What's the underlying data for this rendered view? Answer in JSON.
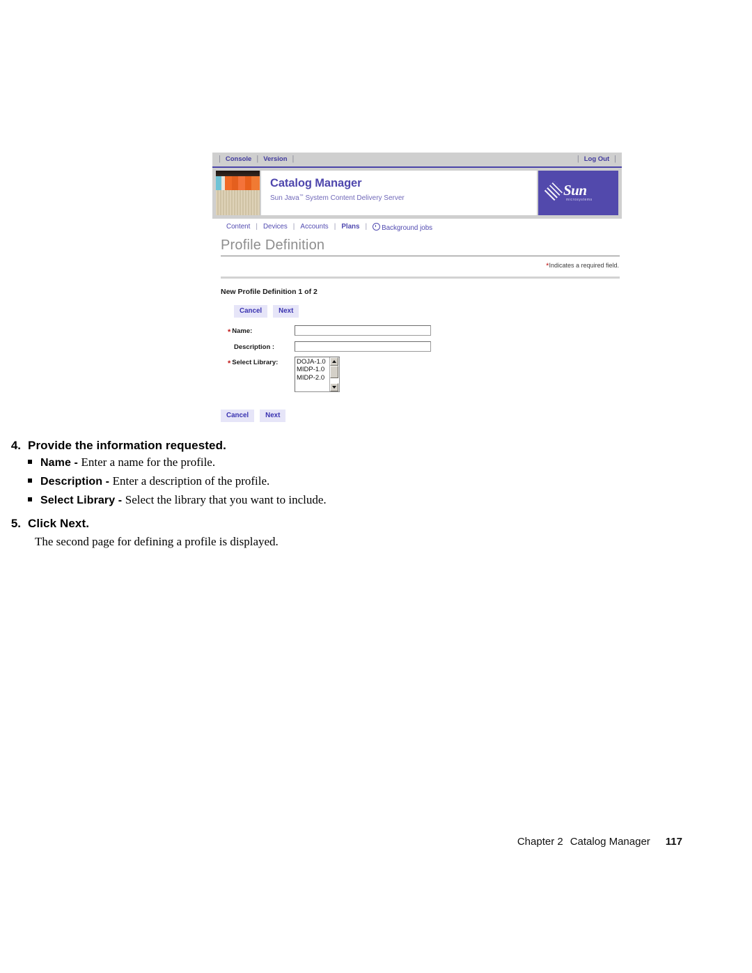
{
  "app": {
    "utility_nav": {
      "left_items": [
        "Console",
        "Version"
      ],
      "right_items": [
        "Log Out"
      ]
    },
    "brand": {
      "title": "Catalog Manager",
      "subtitle_pre": "Sun Java",
      "subtitle_tm": "™",
      "subtitle_post": " System Content Delivery Server",
      "logo_word": "Sun",
      "logo_tagline": "microsystems",
      "logo_bg_color": "#5249ac",
      "title_color": "#4f47ad",
      "banner_bg_color": "#cfcfcf"
    },
    "module_nav": {
      "items": [
        {
          "label": "Content",
          "active": false
        },
        {
          "label": "Devices",
          "active": false
        },
        {
          "label": "Accounts",
          "active": false
        },
        {
          "label": "Plans",
          "active": true
        },
        {
          "label": "Background jobs",
          "active": false,
          "icon": "clock-icon"
        }
      ],
      "separator": "|"
    },
    "page": {
      "heading": "Profile Definition",
      "required_note_star": "*",
      "required_note": "Indicates a required field.",
      "section_title": "New Profile Definition 1 of 2"
    },
    "buttons": {
      "cancel": "Cancel",
      "next": "Next"
    },
    "form": {
      "fields": [
        {
          "label": "Name:",
          "required": true,
          "type": "text",
          "value": "",
          "placeholder": ""
        },
        {
          "label": "Description :",
          "required": false,
          "type": "text",
          "value": "",
          "placeholder": ""
        },
        {
          "label": "Select Library:",
          "required": true,
          "type": "listbox",
          "value": ""
        }
      ],
      "library_options": [
        "DOJA-1.0",
        "MIDP-1.0",
        "MIDP-2.0"
      ],
      "required_marker": "*"
    }
  },
  "document": {
    "steps": [
      {
        "number": "4.",
        "text": "Provide the information requested.",
        "bullets": [
          {
            "term": "Name",
            "dash": " - ",
            "desc": "Enter a name for the profile."
          },
          {
            "term": "Description",
            "dash": " - ",
            "desc": "Enter a description of the profile."
          },
          {
            "term": "Select Library",
            "dash": " - ",
            "desc": "Select the library that you want to include."
          }
        ]
      },
      {
        "number": "5.",
        "text": "Click Next.",
        "paragraph": "The second page for defining a profile is displayed."
      }
    ],
    "footer": {
      "chapter": "Chapter 2",
      "title": "Catalog Manager",
      "page_number": "117"
    }
  }
}
